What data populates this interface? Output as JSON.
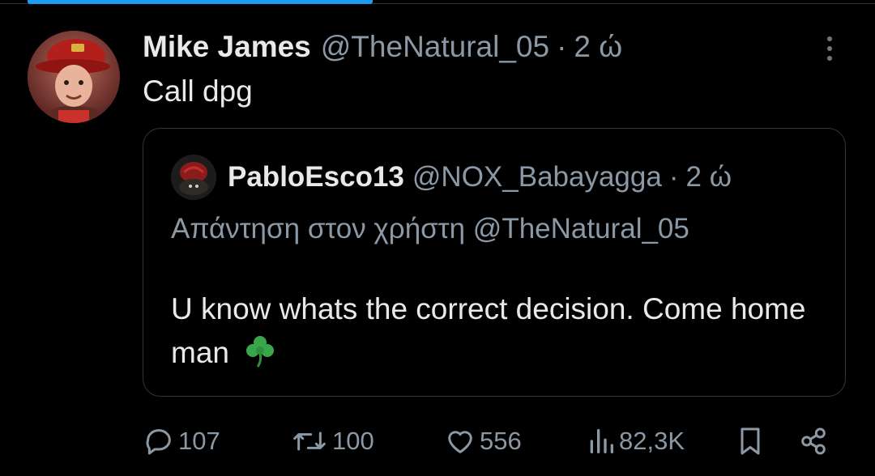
{
  "tweet": {
    "author_name": "Mike James",
    "author_handle": "@TheNatural_05",
    "separator": "·",
    "time": "2 ώ",
    "text": "Call dpg"
  },
  "quote": {
    "author_name": "PabloEsco13",
    "author_handle": "@NOX_Babayagga",
    "separator": "·",
    "time": "2 ώ",
    "reply_to": "Απάντηση στον χρήστη @TheNatural_05",
    "text": "U know whats the correct decision. Come home man"
  },
  "actions": {
    "replies": "107",
    "reposts": "100",
    "likes": "556",
    "views": "82,3K"
  },
  "icons": {
    "more": "more-vertical-icon",
    "reply": "reply-bubble-icon",
    "repost": "repost-icon",
    "like": "heart-icon",
    "views": "views-bar-icon",
    "bookmark": "bookmark-icon",
    "share": "share-icon",
    "emoji": "shamrock-emoji"
  },
  "colors": {
    "background": "#000000",
    "text_primary": "#e7e9ea",
    "text_secondary": "#8b98a5",
    "border": "#333639",
    "accent": "#1d9bf0",
    "emoji_green": "#3aa64c"
  }
}
